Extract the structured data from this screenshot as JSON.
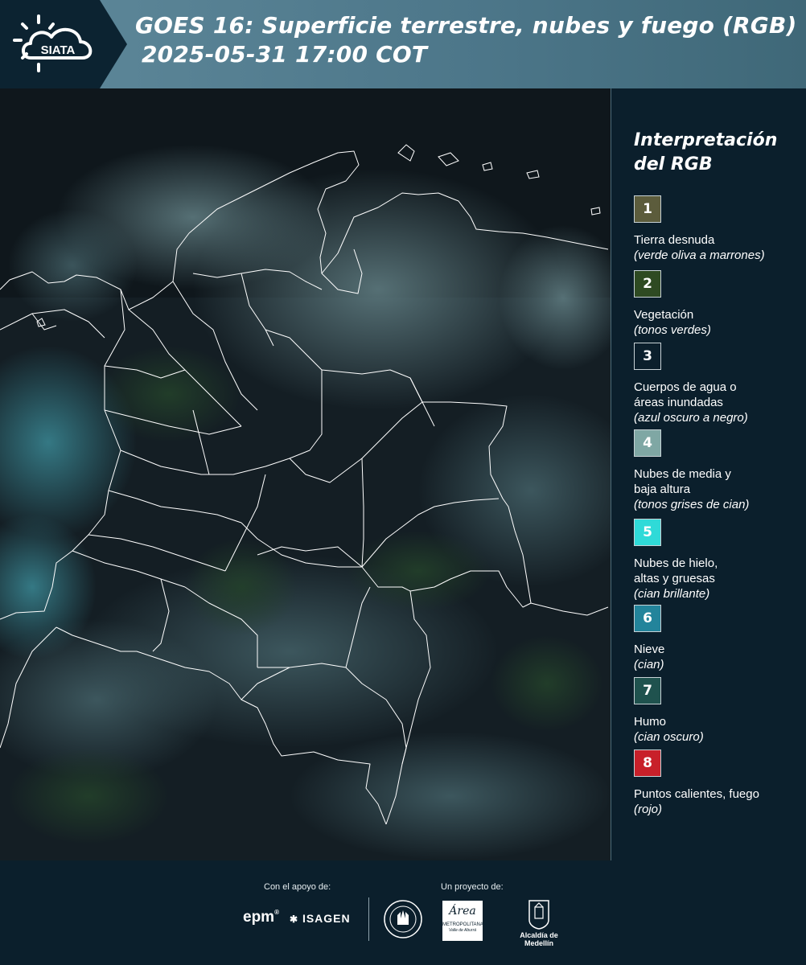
{
  "header": {
    "logo_text": "SIATA",
    "title_line1": "GOES 16: Superficie terrestre, nubes y fuego (RGB)",
    "title_line2": "2025-05-31 17:00 COT"
  },
  "legend": {
    "title_line1": "Interpretación",
    "title_line2": "del RGB",
    "items": [
      {
        "number": "1",
        "color": "#5c5c3c",
        "name": "Tierra desnuda",
        "desc": "(verde oliva a marrones)"
      },
      {
        "number": "2",
        "color": "#2e4a22",
        "name": "Vegetación",
        "desc": "(tonos verdes)"
      },
      {
        "number": "3",
        "color": "#0b1f2c",
        "name": "Cuerpos de agua o\náreas inundadas",
        "desc": "(azul oscuro a negro)"
      },
      {
        "number": "4",
        "color": "#7fa7a4",
        "name": "Nubes de media y\nbaja altura",
        "desc": "(tonos grises de cian)"
      },
      {
        "number": "5",
        "color": "#2fdad8",
        "name": "Nubes de hielo,\naltas y gruesas",
        "desc": "(cian brillante)"
      },
      {
        "number": "6",
        "color": "#23849b",
        "name": "Nieve",
        "desc": "(cian)"
      },
      {
        "number": "7",
        "color": "#1f524e",
        "name": "Humo",
        "desc": "(cian oscuro)"
      },
      {
        "number": "8",
        "color": "#c8202a",
        "name": "Puntos calientes, fuego",
        "desc": "(rojo)"
      }
    ]
  },
  "footer": {
    "support_label": "Con el apoyo de:",
    "project_label": "Un proyecto de:",
    "sponsors": {
      "epm": "epm",
      "isagen": "ISAGEN",
      "area_main": "Área",
      "area_sub": "METROPOLITANA",
      "area_sub2": "Valle de Aburrá",
      "alcaldia": "Alcaldía de Medellín"
    }
  }
}
